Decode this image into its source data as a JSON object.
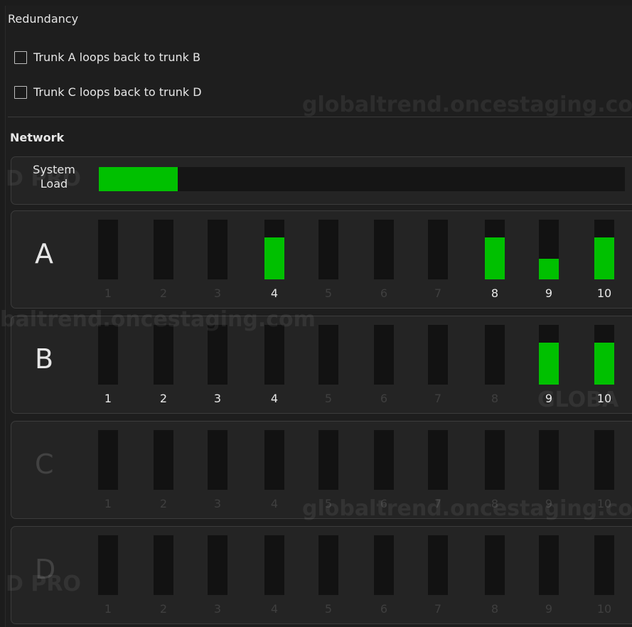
{
  "redundancy": {
    "title": "Redundancy",
    "options": [
      {
        "label": "Trunk A loops back to trunk B",
        "checked": false
      },
      {
        "label": "Trunk C loops back to trunk D",
        "checked": false
      }
    ]
  },
  "network": {
    "title": "Network",
    "system_load": {
      "label_line1": "System",
      "label_line2": "Load",
      "level": 0.15
    },
    "trunks": [
      {
        "letter": "A",
        "active": true,
        "channels": [
          {
            "num": "1",
            "active": false,
            "level": 0
          },
          {
            "num": "2",
            "active": false,
            "level": 0
          },
          {
            "num": "3",
            "active": false,
            "level": 0
          },
          {
            "num": "4",
            "active": true,
            "level": 0.7
          },
          {
            "num": "5",
            "active": false,
            "level": 0
          },
          {
            "num": "6",
            "active": false,
            "level": 0
          },
          {
            "num": "7",
            "active": false,
            "level": 0
          },
          {
            "num": "8",
            "active": true,
            "level": 0.7
          },
          {
            "num": "9",
            "active": true,
            "level": 0.35
          },
          {
            "num": "10",
            "active": true,
            "level": 0.7
          }
        ]
      },
      {
        "letter": "B",
        "active": true,
        "channels": [
          {
            "num": "1",
            "active": true,
            "level": 0
          },
          {
            "num": "2",
            "active": true,
            "level": 0
          },
          {
            "num": "3",
            "active": true,
            "level": 0
          },
          {
            "num": "4",
            "active": true,
            "level": 0
          },
          {
            "num": "5",
            "active": false,
            "level": 0
          },
          {
            "num": "6",
            "active": false,
            "level": 0
          },
          {
            "num": "7",
            "active": false,
            "level": 0
          },
          {
            "num": "8",
            "active": false,
            "level": 0
          },
          {
            "num": "9",
            "active": true,
            "level": 0.7
          },
          {
            "num": "10",
            "active": true,
            "level": 0.7
          }
        ]
      },
      {
        "letter": "C",
        "active": false,
        "channels": [
          {
            "num": "1",
            "active": false,
            "level": 0
          },
          {
            "num": "2",
            "active": false,
            "level": 0
          },
          {
            "num": "3",
            "active": false,
            "level": 0
          },
          {
            "num": "4",
            "active": false,
            "level": 0
          },
          {
            "num": "5",
            "active": false,
            "level": 0
          },
          {
            "num": "6",
            "active": false,
            "level": 0
          },
          {
            "num": "7",
            "active": false,
            "level": 0
          },
          {
            "num": "8",
            "active": false,
            "level": 0
          },
          {
            "num": "9",
            "active": false,
            "level": 0
          },
          {
            "num": "10",
            "active": false,
            "level": 0
          }
        ]
      },
      {
        "letter": "D",
        "active": false,
        "channels": [
          {
            "num": "1",
            "active": false,
            "level": 0
          },
          {
            "num": "2",
            "active": false,
            "level": 0
          },
          {
            "num": "3",
            "active": false,
            "level": 0
          },
          {
            "num": "4",
            "active": false,
            "level": 0
          },
          {
            "num": "5",
            "active": false,
            "level": 0
          },
          {
            "num": "6",
            "active": false,
            "level": 0
          },
          {
            "num": "7",
            "active": false,
            "level": 0
          },
          {
            "num": "8",
            "active": false,
            "level": 0
          },
          {
            "num": "9",
            "active": false,
            "level": 0
          },
          {
            "num": "10",
            "active": false,
            "level": 0
          }
        ]
      }
    ]
  },
  "watermarks": [
    "globaltrend.oncestaging.co",
    "baltrend.oncestaging.com",
    "globaltrend.oncestaging.co",
    "GLOBA",
    "D PRO",
    "D PRO"
  ],
  "colors": {
    "meter_green": "#00c000",
    "meter_bg": "#121212",
    "panel_bg": "#242424"
  }
}
